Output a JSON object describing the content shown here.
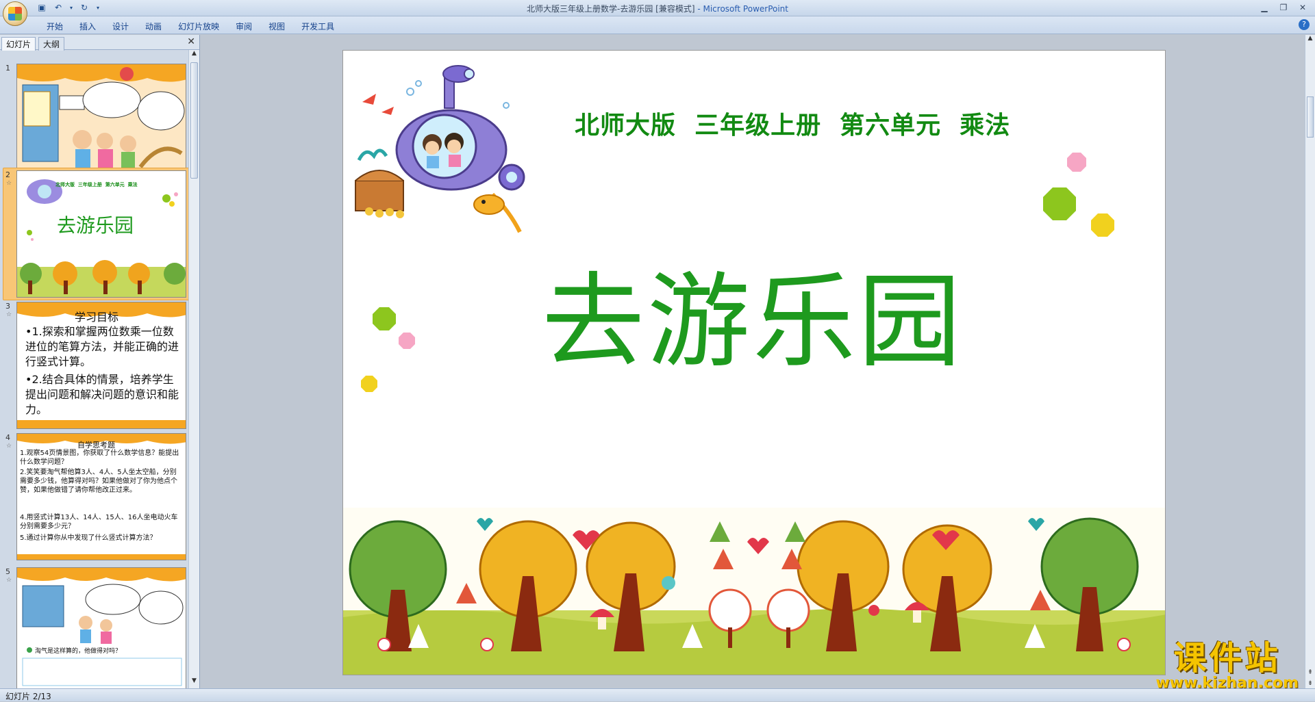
{
  "window": {
    "title": "北师大版三年级上册数学-去游乐园 [兼容模式]",
    "app_name": "- Microsoft PowerPoint"
  },
  "ribbon_tabs": [
    "开始",
    "插入",
    "设计",
    "动画",
    "幻灯片放映",
    "审阅",
    "视图",
    "开发工具"
  ],
  "left_pane": {
    "tab_slides": "幻灯片",
    "tab_outline": "大纲",
    "close_glyph": "✕"
  },
  "thumbnails": [
    {
      "number": "1",
      "star": ""
    },
    {
      "number": "2",
      "star": "☆",
      "subtitle": "北师大版  三年级上册  第六单元  乘法",
      "title": "去游乐园"
    },
    {
      "number": "3",
      "star": "☆",
      "heading": "学习目标",
      "bullets": [
        "•1.探索和掌握两位数乘一位数进位的笔算方法，并能正确的进行竖式计算。",
        "•2.结合具体的情景，培养学生提出问题和解决问题的意识和能力。"
      ]
    },
    {
      "number": "4",
      "star": "☆",
      "heading": "自学思考题",
      "lines": [
        "1.观察54页情景图，你获取了什么数学信息？能提出什么数学问题？",
        "2.笑笑要淘气帮他算3人、4人、5人坐太空船，分别需要多少钱，他算得对吗？如果他做对了你为他点个赞，如果他做错了请你帮他改正过来。",
        "4.用竖式计算13人、14人、15人、16人坐电动火车分别需要多少元？",
        "5.通过计算你从中发现了什么竖式计算方法？"
      ]
    },
    {
      "number": "5",
      "star": "☆",
      "caption": "淘气是这样算的，他做得对吗？"
    }
  ],
  "slide": {
    "subtitle": "北师大版  三年级上册  第六单元  乘法",
    "title": "去游乐园"
  },
  "status": {
    "slide_counter": "幻灯片 2/13"
  },
  "watermark": {
    "brand": "课件站",
    "url": "www.kjzhan.com"
  },
  "colors": {
    "title_green": "#1e9a1e",
    "subtitle_green": "#128a12",
    "selection_orange": "#f8c676",
    "ribbon_blue": "#15428b"
  }
}
